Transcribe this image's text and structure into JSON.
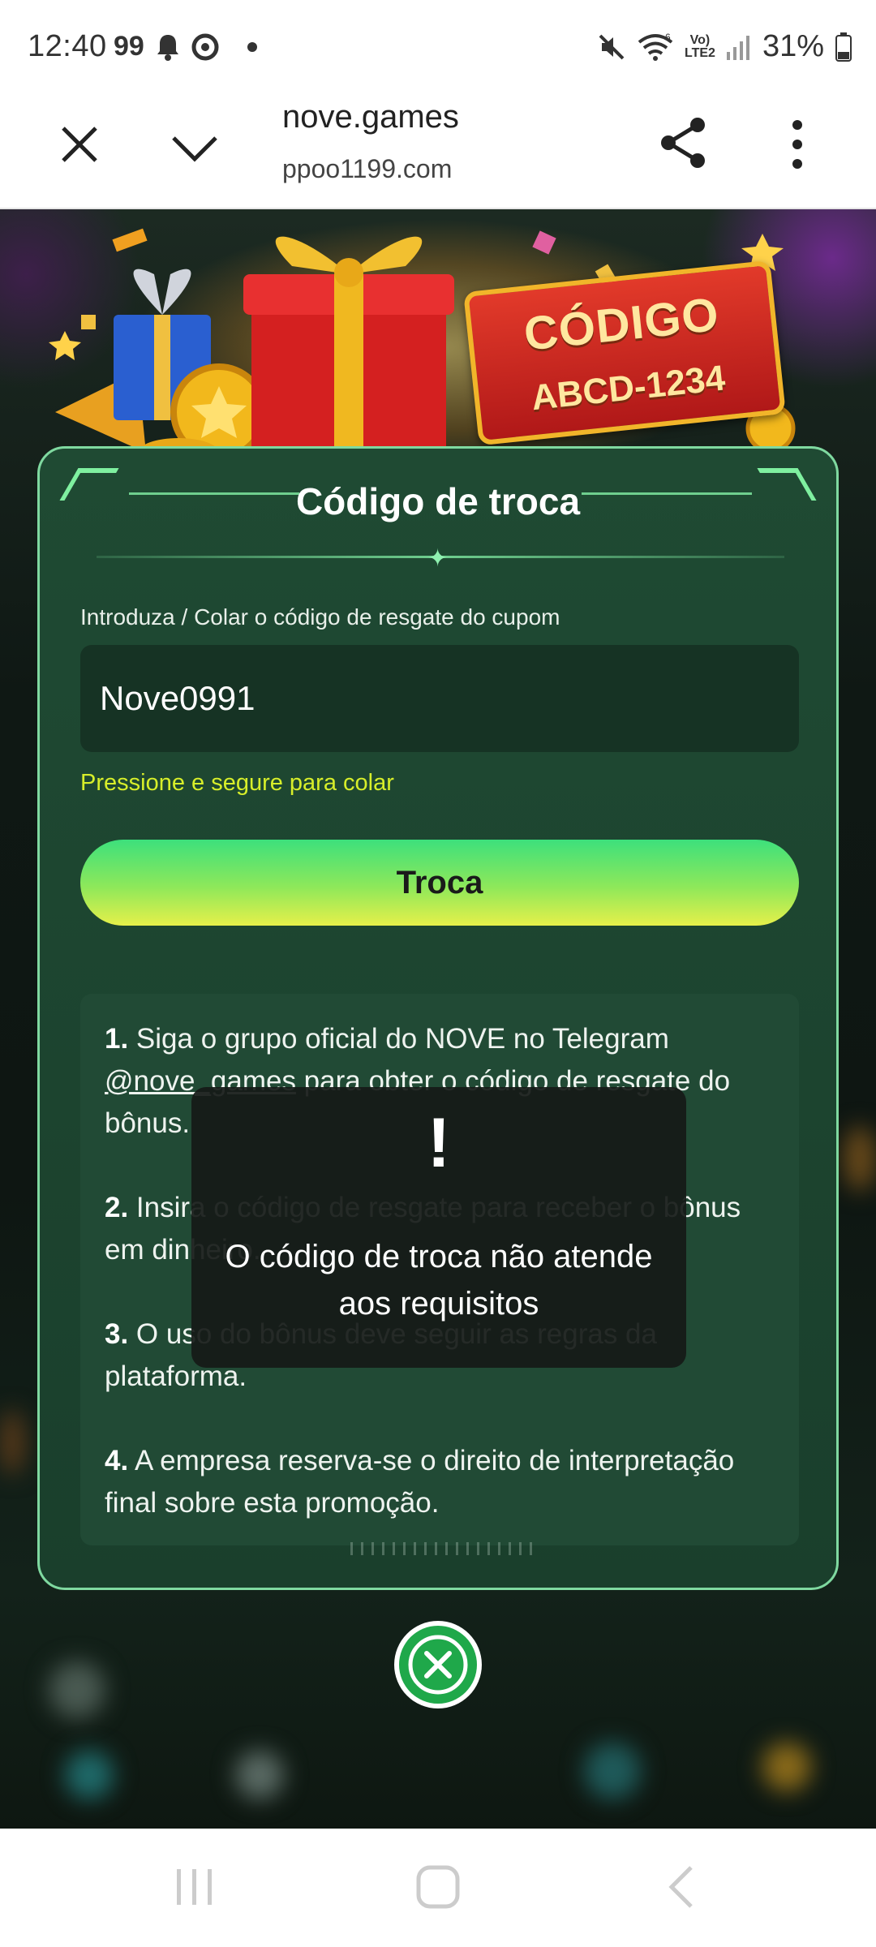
{
  "status_bar": {
    "time": "12:40",
    "badge": "99",
    "battery": "31%",
    "net_top": "Vo)",
    "net_bottom": "LTE2",
    "wifi_num": "6",
    "icons": [
      "bell-icon",
      "chrome-icon",
      "dot-icon",
      "mute-icon",
      "wifi-icon",
      "signal-icon",
      "battery-icon"
    ]
  },
  "browser": {
    "title": "nove.games",
    "url": "ppoo1199.com",
    "icons": [
      "close-icon",
      "chevron-down-icon",
      "share-icon",
      "more-vert-icon"
    ]
  },
  "banner": {
    "code_title": "CÓDIGO",
    "code_value": "ABCD-1234"
  },
  "modal": {
    "title": "Código de troca",
    "input_label": "Introduza / Colar o código de resgate do cupom",
    "input_value": "Nove0991",
    "hint": "Pressione e segure para colar",
    "button_label": "Troca",
    "rules": [
      {
        "num": "1.",
        "pre": " Siga o grupo oficial do NOVE no Telegram ",
        "link": "@nove_games",
        "post": " para obter o código de resgate do bônus."
      },
      {
        "num": "2.",
        "text": " Insira o código de resgate para receber o bônus em dinheiro."
      },
      {
        "num": "3.",
        "text": " O uso do bônus deve seguir as regras da plataforma."
      },
      {
        "num": "4.",
        "text": " A empresa reserva-se o direito de interpretação final sobre esta promoção."
      }
    ]
  },
  "toast": {
    "mark": "!",
    "message": "O código de troca não atende aos requisitos"
  },
  "colors": {
    "accent_green": "#3de07c",
    "accent_yellow": "#e6f04a",
    "hint_yellow": "#d7ee2a",
    "card_bg": "#1f4a33"
  }
}
